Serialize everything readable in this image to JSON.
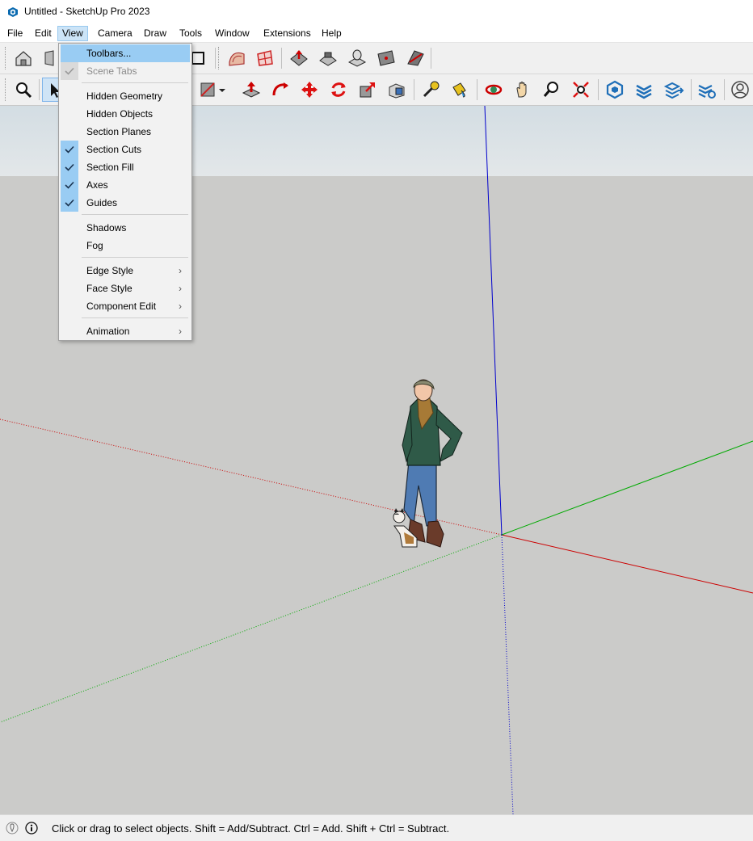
{
  "window": {
    "title": "Untitled - SketchUp Pro 2023",
    "app_icon": "sketchup-logo-icon"
  },
  "menubar": {
    "items": [
      "File",
      "Edit",
      "View",
      "Camera",
      "Draw",
      "Tools",
      "Window",
      "Extensions",
      "Help"
    ],
    "active": "View"
  },
  "view_menu": {
    "toolbars": "Toolbars...",
    "scene_tabs": "Scene Tabs",
    "hidden_geometry": "Hidden Geometry",
    "hidden_objects": "Hidden Objects",
    "section_planes": "Section Planes",
    "section_cuts": "Section Cuts",
    "section_fill": "Section Fill",
    "axes": "Axes",
    "guides": "Guides",
    "shadows": "Shadows",
    "fog": "Fog",
    "edge_style": "Edge Style",
    "face_style": "Face Style",
    "component_edit": "Component Edit",
    "animation": "Animation",
    "submenu_arrow": "›",
    "checked": [
      "Scene Tabs",
      "Section Cuts",
      "Section Fill",
      "Axes",
      "Guides"
    ],
    "disabled": [
      "Scene Tabs"
    ],
    "highlighted": "Toolbars..."
  },
  "toolbar_icons": {
    "row1": [
      "home-warehouse-icon",
      "3d-warehouse-icon",
      "rectangle-icon",
      "sandbox-contours-icon",
      "sandbox-scratch-icon",
      "smoove-icon",
      "stamp-icon",
      "drape-icon",
      "add-detail-icon",
      "flip-edge-icon"
    ],
    "row2": [
      "zoom-icon",
      "select-icon",
      "eraser-icon",
      "push-pull-icon",
      "follow-me-icon",
      "move-icon",
      "rotate-icon",
      "scale-icon",
      "offset-icon",
      "tape-measure-icon",
      "paint-bucket-icon",
      "orbit-icon",
      "pan-icon",
      "zoom-window-icon",
      "zoom-extents-icon",
      "warehouse-icon",
      "layers-icon",
      "tags-icon",
      "tag-settings-icon",
      "account-icon"
    ]
  },
  "status": {
    "text": "Click or drag to select objects. Shift = Add/Subtract. Ctrl = Add. Shift + Ctrl = Subtract.",
    "icons": [
      "geo-location-icon",
      "info-icon"
    ]
  },
  "scene": {
    "axis_colors": {
      "red": "#cc0000",
      "green": "#00aa00",
      "blue": "#0000cc"
    },
    "viewport_bg": "#cbcbc9",
    "objects": [
      "person-figure",
      "cat-figure"
    ]
  }
}
